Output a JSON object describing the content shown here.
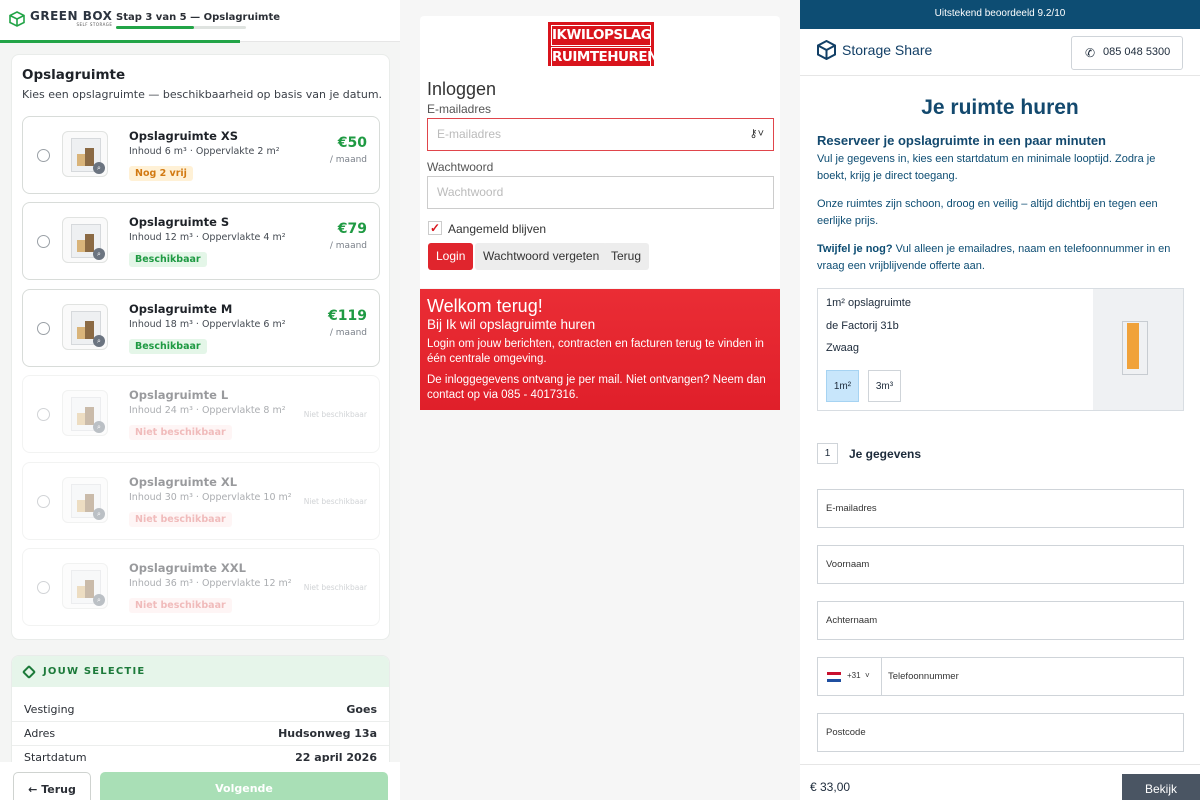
{
  "greenbox": {
    "brand": "GREEN BOX",
    "brand_sub": "SELF STORAGE",
    "step_label": "Stap 3 van 5 — Opslagruimte",
    "step_progress": 0.6,
    "title": "Opslagruimte",
    "subtitle": "Kies een opslagruimte — beschikbaarheid op basis van je datum.",
    "units": [
      {
        "name": "Opslagruimte XS",
        "specs": "Inhoud 6 m³  ·  Oppervlakte 2 m²",
        "badge": "Nog 2 vrij",
        "status": "warn",
        "price": "€50",
        "per": "/ maand",
        "available": true
      },
      {
        "name": "Opslagruimte S",
        "specs": "Inhoud 12 m³  ·  Oppervlakte 4 m²",
        "badge": "Beschikbaar",
        "status": "ok",
        "price": "€79",
        "per": "/ maand",
        "available": true
      },
      {
        "name": "Opslagruimte M",
        "specs": "Inhoud 18 m³  ·  Oppervlakte 6 m²",
        "badge": "Beschikbaar",
        "status": "ok",
        "price": "€119",
        "per": "/ maand",
        "available": true
      },
      {
        "name": "Opslagruimte L",
        "specs": "Inhoud 24 m³  ·  Oppervlakte 8 m²",
        "badge": "Niet beschikbaar",
        "status": "no",
        "na": "Niet beschikbaar",
        "available": false
      },
      {
        "name": "Opslagruimte XL",
        "specs": "Inhoud 30 m³  ·  Oppervlakte 10 m²",
        "badge": "Niet beschikbaar",
        "status": "no",
        "na": "Niet beschikbaar",
        "available": false
      },
      {
        "name": "Opslagruimte XXL",
        "specs": "Inhoud 36 m³  ·  Oppervlakte 12 m²",
        "badge": "Niet beschikbaar",
        "status": "no",
        "na": "Niet beschikbaar",
        "available": false
      }
    ],
    "selection": {
      "heading": "JOUW SELECTIE",
      "rows": [
        {
          "label": "Vestiging",
          "value": "Goes"
        },
        {
          "label": "Adres",
          "value": "Hudsonweg 13a"
        },
        {
          "label": "Startdatum",
          "value": "22 april 2026"
        }
      ]
    },
    "back_label": "← Terug",
    "next_label": "Volgende",
    "accent": "#22a447"
  },
  "ikwil": {
    "logo_line1": "IKWILOPSLAG",
    "logo_line2": "RUIMTEHUREN.NL",
    "heading": "Inloggen",
    "email_label": "E-mailadres",
    "email_placeholder": "E-mailadres",
    "password_label": "Wachtwoord",
    "password_placeholder": "Wachtwoord",
    "remember_label": "Aangemeld blijven",
    "remember_checked": true,
    "login_button": "Login",
    "forgot_button": "Wachtwoord vergeten",
    "back_button": "Terug",
    "welcome_title": "Welkom terug!",
    "welcome_subtitle": "Bij Ik wil opslagruimte huren",
    "welcome_text1": "Login om jouw berichten, contracten en facturen terug te vinden in één centrale omgeving.",
    "welcome_text2": "De inloggegevens ontvang je per mail. Niet ontvangen? Neem dan contact op via 085 - 4017316.",
    "accent": "#e0252d"
  },
  "storageshare": {
    "topbar": "Uitstekend beoordeeld  9.2/10",
    "brand": "Storage Share",
    "phone": "085 048 5300",
    "title": "Je ruimte huren",
    "intro_heading": "Reserveer je opslagruimte in een paar minuten",
    "intro_p1": "Vul je gegevens in, kies een startdatum en minimale looptijd. Zodra je boekt, krijg je direct toegang.",
    "intro_p2": "Onze ruimtes zijn schoon, droog en veilig – altijd dichtbij en tegen een eerlijke prijs.",
    "intro_p3_bold": "Twijfel je nog?",
    "intro_p3_rest": " Vul alleen je emailadres, naam en telefoonnummer in en vraag een vrijblijvende offerte aan.",
    "unit_title": "1m² opslagruimte",
    "unit_address": "de Factorij 31b",
    "unit_city": "Zwaag",
    "sizes": [
      "1m²",
      "3m³"
    ],
    "selected_size": "1m²",
    "step_number": "1",
    "step_title": "Je gegevens",
    "fields": {
      "email": "E-mailadres",
      "firstname": "Voornaam",
      "lastname": "Achternaam",
      "country_code": "+31",
      "phone": "Telefoonnummer",
      "postcode": "Postcode"
    },
    "price": "€ 33,00",
    "view_button": "Bekijk",
    "brand_color": "#0d4d73"
  }
}
